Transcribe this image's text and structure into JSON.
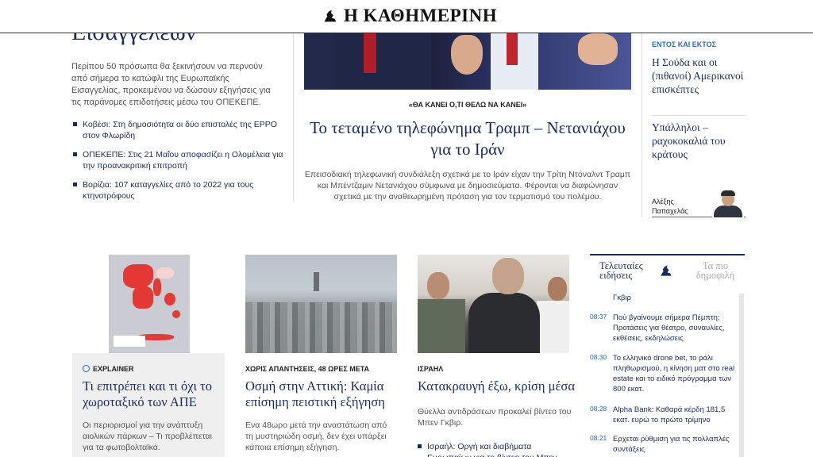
{
  "header": {
    "logo_text": "Η ΚΑΘΗΜΕΡΙΝΗ"
  },
  "lead": {
    "title": "Εισαγγελέων",
    "summary": "Περίπου 50 πρόσωπα θα ξεκινήσουν να περνούν από σήμερα το κατώφλι της Ευρωπαϊκής Εισαγγελίας, προκειμένου να δώσουν εξηγήσεις για τις παράνομες επιδοτήσεις μέσω του ΟΠΕΚΕΠΕ.",
    "links": [
      "Κοβέσι: Στη δημοσιότητα οι δύο επιστολές της EPPO στον Φλωρίδη",
      "ΟΠΕΚΕΠΕ: Στις 21 Μαΐου αποφασίζει η Ολομέλεια για την προανακριτική επιτροπή",
      "Βορίζια: 107 καταγγελίες από το 2022 για τους κτηνοτρόφους"
    ]
  },
  "hero": {
    "kicker": "«ΘΑ ΚΑΝΕΙ Ο,ΤΙ ΘΕΛΩ ΝΑ ΚΑΝΕΙ»",
    "title": "Το τεταμένο τηλεφώνημα Τραμπ – Νετανιάχου για το Ιράν",
    "summary": "Επεισοδιακή τηλεφωνική συνδιάλεξη σχετικά με το Ιράν είχαν την Τρίτη Ντόναλντ Τραμπ και Μπέντζαμιν Νετανιάχου σύμφωνα με δημοσιεύματα. Φέρονται να διαφώνησαν σχετικά με την αναθεωρημένη πρόταση για τον τερματισμό του πολέμου."
  },
  "right_column": {
    "section": "ΕΝΤΟΣ ΚΑΙ ΕΚΤΟΣ",
    "items": [
      "Η Σούδα και οι (πιθανοί) Αμερικανοί επισκέπτες",
      "Υπάλληλοι – ραχοκοκαλιά του κράτους"
    ],
    "author": "Αλέξης Παπαχελάς"
  },
  "cards": [
    {
      "kicker": "EXPLAINER",
      "title": "Τι επιτρέπει και τι όχι το χωροταξικό των ΑΠΕ",
      "summary": "Οι περιορισμοί για την ανάπτυξη αιολικών πάρκων – Τι προβλέπεται για τα φωτοβολταϊκά."
    },
    {
      "kicker": "ΧΩΡΙΣ ΑΠΑΝΤΗΣΕΙΣ, 48 ΩΡΕΣ ΜΕΤΑ",
      "title": "Οσμή στην Αττική: Καμία επίσημη πειστική εξήγηση",
      "summary": "Ενα 48ωρο μετά την αναστάτωση από τη μυστηριώδη οσμή, δεν έχει υπάρξει κάποια επίσημη εξήγηση."
    },
    {
      "kicker": "ΙΣΡΑΗΛ",
      "title": "Κατακραυγή έξω, κρίση μέσα",
      "summary": "Θύελλα αντιδράσεων προκαλεί βίντεο του Μπεν Γκβιρ.",
      "link": "Ισραήλ: Οργή και διαβήματα Ευρωπαίων για το βίντεο του Μπεν Γκβιρ"
    }
  ],
  "news": {
    "tab_latest": "Τελευταίες ειδήσεις",
    "tab_popular": "Τα πιο δημοφιλή",
    "first_line": "Γκβιρ",
    "items": [
      {
        "time": "08:37",
        "text": "Πού βγαίνουμε σήμερα Πέμπτη; Προτάσεις για θέατρο, συναυλίες, εκθέσεις, εκδηλώσεις"
      },
      {
        "time": "08:30",
        "text": "Το ελληνικό drone bet, το ράλι πληθωρισμού, η κίνηση ματ στο real estate και το ειδικό πρόγραμμα των 800 εκατ."
      },
      {
        "time": "08:28",
        "text": "Alpha Bank: Καθαρά κέρδη 181,5 εκατ. ευρώ το πρώτο τρίμηνο"
      },
      {
        "time": "08:21",
        "text": "Ερχεται ρύθμιση για τις πολλαπλές συντάξεις"
      }
    ]
  },
  "colors": {
    "brand_navy": "#1a2b5c",
    "accent_blue": "#2a6db5"
  }
}
